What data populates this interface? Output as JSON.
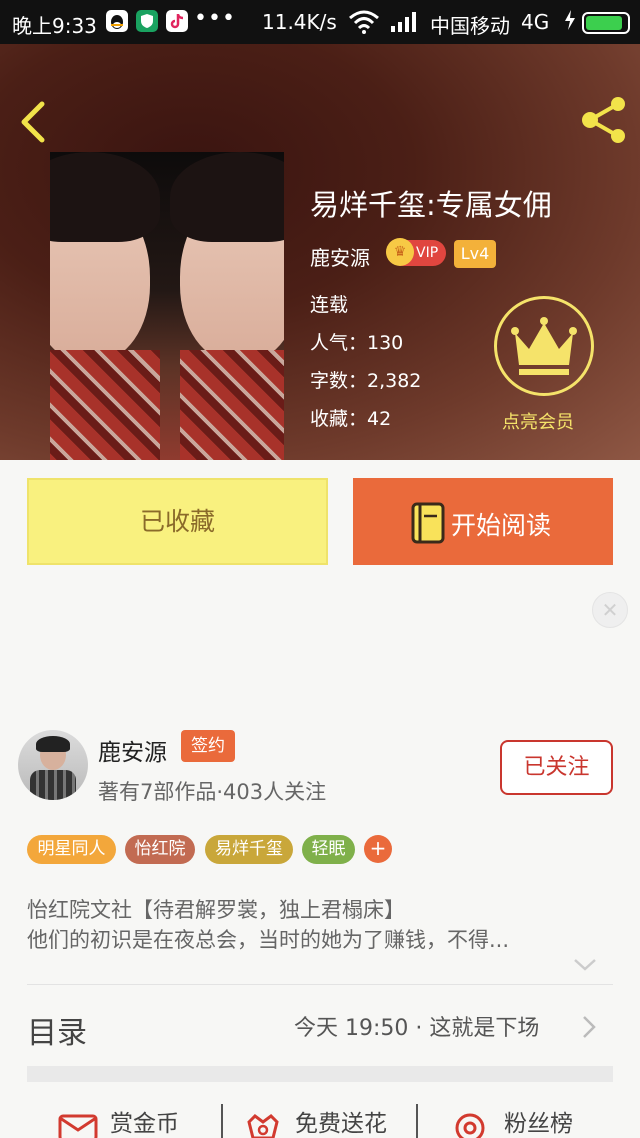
{
  "status_bar": {
    "time": "晚上9:33",
    "dots": "•••",
    "net_speed": "11.4K/s",
    "carrier": "中国移动",
    "network": "4G",
    "icons": [
      "qq-icon",
      "shield-app-icon",
      "tiktok-icon",
      "wifi-icon",
      "signal-icon",
      "charging-icon",
      "battery-icon"
    ]
  },
  "book": {
    "title": "易烊千玺:专属女佣",
    "author": "鹿安源",
    "vip_label": "VIP",
    "level": "Lv4",
    "status": "连载",
    "popularity": "人气：130",
    "word_count": "字数：2,382",
    "favorites": "收藏：42"
  },
  "member": {
    "label": "点亮会员"
  },
  "actions": {
    "favorited_label": "已收藏",
    "read_label": "开始阅读"
  },
  "author_card": {
    "name": "鹿安源",
    "sign_badge": "签约",
    "stats": "著有7部作品·403人关注",
    "follow_label": "已关注"
  },
  "tags": [
    {
      "label": "明星同人",
      "color": "#f3a73b"
    },
    {
      "label": "怡红院",
      "color": "#c26b52"
    },
    {
      "label": "易烊千玺",
      "color": "#c9a73a"
    },
    {
      "label": "轻眠",
      "color": "#7fb04a"
    }
  ],
  "tag_add": "+",
  "description": {
    "line1": "怡红院文社【待君解罗裳，独上君榻床】",
    "line2": "他们的初识是在夜总会，当时的她为了赚钱，不得..."
  },
  "toc": {
    "title": "目录",
    "latest": "今天 19:50 · 这就是下场"
  },
  "bottom_bar": [
    {
      "label": "赏金币",
      "icon": "coin-envelope-icon"
    },
    {
      "label": "免费送花",
      "icon": "flower-icon"
    },
    {
      "label": "粉丝榜",
      "icon": "fan-rank-icon"
    }
  ],
  "colors": {
    "accent_orange": "#ea6a3b",
    "favorite_yellow": "#f9f17f",
    "follow_red": "#c9362e",
    "member_gold": "#f5e36a"
  }
}
